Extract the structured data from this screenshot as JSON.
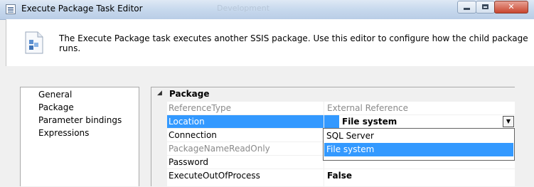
{
  "window": {
    "title": "Execute Package Task Editor",
    "background_title": "Development"
  },
  "header": {
    "description": "The Execute Package task executes another SSIS package. Use this editor to configure how the child package runs."
  },
  "nav": {
    "items": [
      {
        "label": "General",
        "selected": false
      },
      {
        "label": "Package",
        "selected": true
      },
      {
        "label": "Parameter bindings",
        "selected": false
      },
      {
        "label": "Expressions",
        "selected": false
      }
    ]
  },
  "grid": {
    "category": "Package",
    "category_toggle": "◢",
    "rows": [
      {
        "name": "ReferenceType",
        "value": "External Reference",
        "readonly": true
      },
      {
        "name": "Location",
        "value": "File system",
        "selected": true
      },
      {
        "name": "Connection",
        "value": ""
      },
      {
        "name": "PackageNameReadOnly",
        "value": "",
        "readonly": true
      },
      {
        "name": "Password",
        "value": ""
      },
      {
        "name": "ExecuteOutOfProcess",
        "value": "False"
      }
    ]
  },
  "dropdown": {
    "options": [
      {
        "label": "SQL Server",
        "selected": false
      },
      {
        "label": "File system",
        "selected": true
      }
    ],
    "arrow": "▼"
  },
  "colors": {
    "selection": "#3399ff",
    "close_button": "#c9462f"
  }
}
